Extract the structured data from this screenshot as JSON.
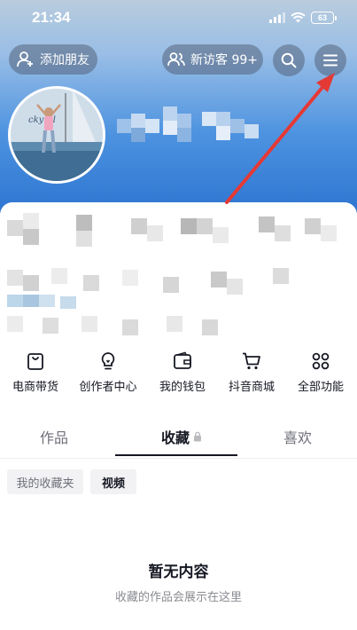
{
  "status_bar": {
    "time": "21:34",
    "battery": "63"
  },
  "header": {
    "add_friend_label": "添加朋友",
    "visitors_label": "新访客 99+"
  },
  "shortcuts": [
    {
      "label": "电商带货",
      "icon": "shopping-bag-icon"
    },
    {
      "label": "创作者中心",
      "icon": "lightbulb-icon"
    },
    {
      "label": "我的钱包",
      "icon": "wallet-icon"
    },
    {
      "label": "抖音商城",
      "icon": "cart-icon"
    },
    {
      "label": "全部功能",
      "icon": "grid-icon"
    }
  ],
  "tabs": [
    {
      "label": "作品",
      "active": false
    },
    {
      "label": "收藏",
      "active": true
    },
    {
      "label": "喜欢",
      "active": false
    }
  ],
  "filters": {
    "folder_label": "我的收藏夹",
    "video_label": "视频"
  },
  "empty_state": {
    "title": "暂无内容",
    "subtitle": "收藏的作品会展示在这里"
  },
  "colors": {
    "accent_arrow": "#e53935",
    "header_gradient_top": "#b9ccdd",
    "header_gradient_bottom": "#2a72d0"
  }
}
